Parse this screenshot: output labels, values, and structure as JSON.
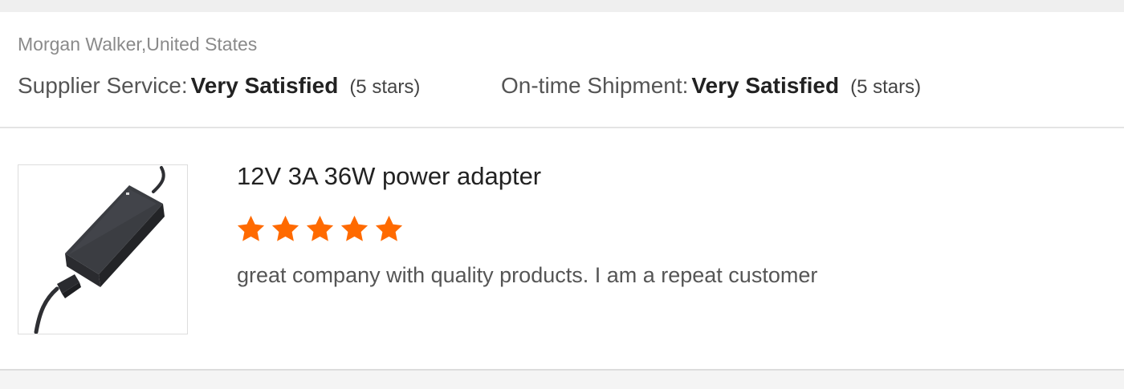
{
  "review": {
    "reviewer": "Morgan Walker,United States",
    "supplier_service": {
      "label": "Supplier Service:",
      "value": "Very Satisfied",
      "stars_text": "(5 stars)"
    },
    "ontime_shipment": {
      "label": "On-time Shipment:",
      "value": "Very Satisfied",
      "stars_text": "(5 stars)"
    }
  },
  "product": {
    "title": "12V 3A 36W power adapter",
    "thumbnail_icon": "power-adapter-image",
    "rating": 5,
    "rating_max": 5,
    "star_color": "#ff6a00",
    "comment": "great company with quality products. I am a repeat customer"
  }
}
